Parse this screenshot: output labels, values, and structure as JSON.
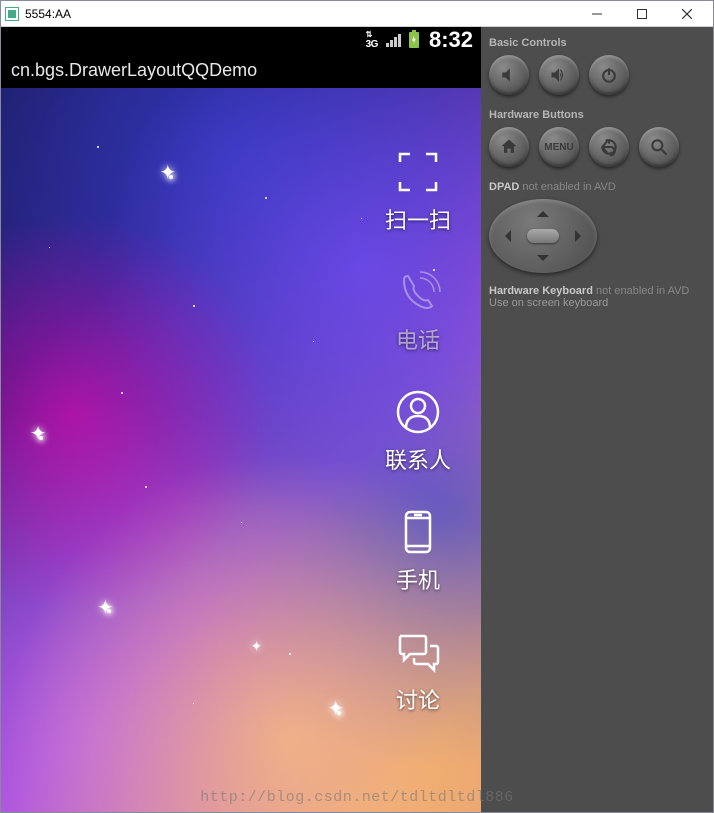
{
  "window": {
    "title": "5554:AA"
  },
  "status_bar": {
    "network_type": "3G",
    "time": "8:32"
  },
  "app": {
    "title": "cn.bgs.DrawerLayoutQQDemo"
  },
  "menu": [
    {
      "id": "scan",
      "label": "扫一扫",
      "icon": "scan-icon"
    },
    {
      "id": "phone",
      "label": "电话",
      "icon": "phone-icon",
      "dim": true
    },
    {
      "id": "contacts",
      "label": "联系人",
      "icon": "contacts-icon"
    },
    {
      "id": "mobile",
      "label": "手机",
      "icon": "mobile-icon"
    },
    {
      "id": "discuss",
      "label": "讨论",
      "icon": "discuss-icon"
    }
  ],
  "side_panel": {
    "basic_controls_title": "Basic Controls",
    "hardware_buttons_title": "Hardware Buttons",
    "menu_btn_label": "MENU",
    "dpad_title": "DPAD",
    "dpad_note": "not enabled in AVD",
    "keyboard_title": "Hardware Keyboard",
    "keyboard_note": "not enabled in AVD",
    "keyboard_hint": "Use on screen keyboard"
  },
  "watermark": "http://blog.csdn.net/tdltdltdl886"
}
